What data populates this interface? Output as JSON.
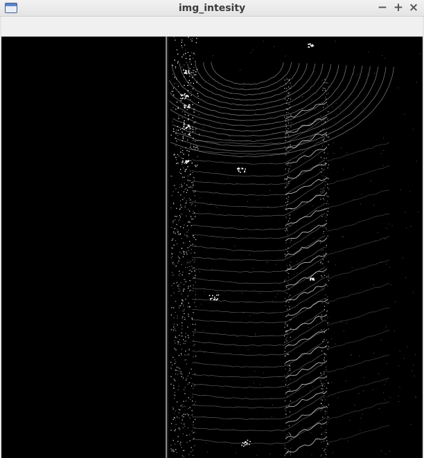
{
  "window": {
    "title": "img_intesity",
    "controls": {
      "minimize": "−",
      "maximize": "+",
      "close": "×"
    },
    "app_icon": "window-icon"
  },
  "image": {
    "description_kind": "lidar-intensity-image",
    "background_color": "#000000",
    "point_color": "#ffffff"
  }
}
